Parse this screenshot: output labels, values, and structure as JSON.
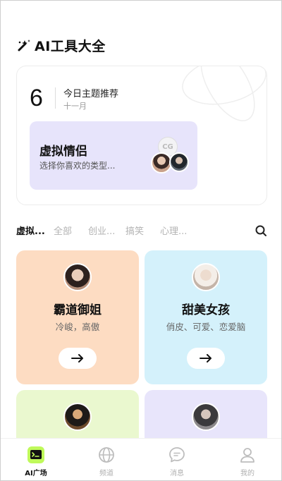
{
  "header": {
    "title": "AI工具大全",
    "logo_icon": "magic-wand-icon"
  },
  "theme": {
    "day": "6",
    "label": "今日主题推荐",
    "month": "十一月",
    "feature": {
      "title": "虚拟情侣",
      "subtitle": "选择你喜欢的类型...",
      "badge": "CG"
    }
  },
  "tabs": {
    "items": [
      {
        "label": "虚拟..."
      },
      {
        "label": "全部"
      },
      {
        "label": "创业..."
      },
      {
        "label": "搞笑"
      },
      {
        "label": "心理..."
      }
    ],
    "active_index": 0,
    "search_icon": "search-icon"
  },
  "cards": [
    {
      "name": "霸道御姐",
      "desc": "冷峻，高傲",
      "color": "#fddcc2"
    },
    {
      "name": "甜美女孩",
      "desc": "俏皮、可爱、恋爱脑",
      "color": "#d4f1fb"
    },
    {
      "name": "",
      "desc": "",
      "color": "#eaf8cf"
    },
    {
      "name": "",
      "desc": "",
      "color": "#e8e5fb"
    }
  ],
  "nav": {
    "items": [
      {
        "label": "AI广场",
        "icon": "terminal-icon"
      },
      {
        "label": "频道",
        "icon": "globe-icon"
      },
      {
        "label": "消息",
        "icon": "chat-icon"
      },
      {
        "label": "我的",
        "icon": "user-icon"
      }
    ],
    "active_index": 0,
    "accent": "#bff95a"
  }
}
